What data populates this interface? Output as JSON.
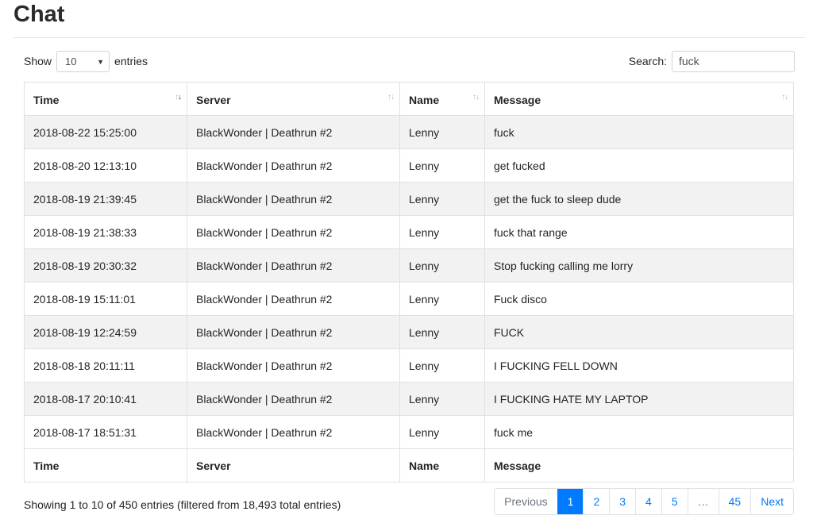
{
  "page": {
    "title": "Chat"
  },
  "controls": {
    "show_label": "Show",
    "entries_label": "entries",
    "length_value": "10",
    "search_label": "Search:",
    "search_value": "fuck"
  },
  "table": {
    "columns": [
      "Time",
      "Server",
      "Name",
      "Message"
    ],
    "rows": [
      {
        "time": "2018-08-22 15:25:00",
        "server": "BlackWonder | Deathrun #2",
        "name": "Lenny",
        "message": "fuck"
      },
      {
        "time": "2018-08-20 12:13:10",
        "server": "BlackWonder | Deathrun #2",
        "name": "Lenny",
        "message": "get fucked"
      },
      {
        "time": "2018-08-19 21:39:45",
        "server": "BlackWonder | Deathrun #2",
        "name": "Lenny",
        "message": "get the fuck to sleep dude"
      },
      {
        "time": "2018-08-19 21:38:33",
        "server": "BlackWonder | Deathrun #2",
        "name": "Lenny",
        "message": "fuck that range"
      },
      {
        "time": "2018-08-19 20:30:32",
        "server": "BlackWonder | Deathrun #2",
        "name": "Lenny",
        "message": "Stop fucking calling me lorry"
      },
      {
        "time": "2018-08-19 15:11:01",
        "server": "BlackWonder | Deathrun #2",
        "name": "Lenny",
        "message": "Fuck disco"
      },
      {
        "time": "2018-08-19 12:24:59",
        "server": "BlackWonder | Deathrun #2",
        "name": "Lenny",
        "message": "FUCK"
      },
      {
        "time": "2018-08-18 20:11:11",
        "server": "BlackWonder | Deathrun #2",
        "name": "Lenny",
        "message": "I FUCKING FELL DOWN"
      },
      {
        "time": "2018-08-17 20:10:41",
        "server": "BlackWonder | Deathrun #2",
        "name": "Lenny",
        "message": "I FUCKING HATE MY LAPTOP"
      },
      {
        "time": "2018-08-17 18:51:31",
        "server": "BlackWonder | Deathrun #2",
        "name": "Lenny",
        "message": "fuck me"
      }
    ],
    "sort_icon": "sort-arrows-icon"
  },
  "footer": {
    "info": "Showing 1 to 10 of 450 entries (filtered from 18,493 total entries)"
  },
  "pagination": {
    "previous": "Previous",
    "pages": [
      "1",
      "2",
      "3",
      "4",
      "5"
    ],
    "ellipsis": "…",
    "last": "45",
    "next": "Next",
    "active": "1"
  }
}
